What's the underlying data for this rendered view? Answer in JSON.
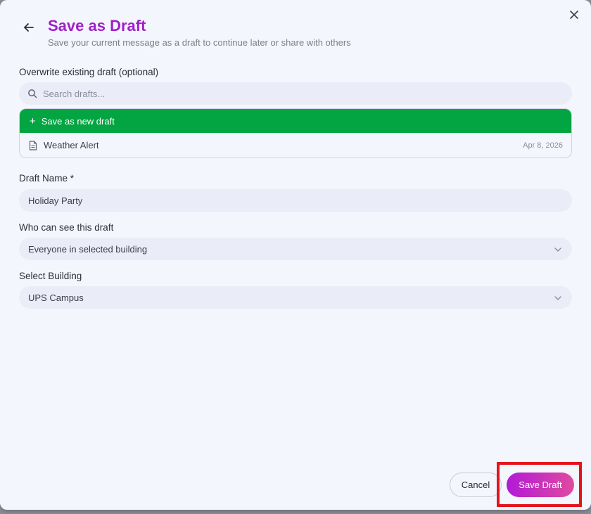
{
  "dialog": {
    "title": "Save as Draft",
    "subtitle": "Save your current message as a draft to continue later or share with others"
  },
  "overwrite": {
    "label": "Overwrite existing draft (optional)",
    "search_placeholder": "Search drafts...",
    "new_draft_label": "Save as new draft",
    "drafts": [
      {
        "name": "Weather Alert",
        "date": "Apr 8, 2026"
      }
    ]
  },
  "draft_name": {
    "label": "Draft Name *",
    "value": "Holiday Party"
  },
  "visibility": {
    "label": "Who can see this draft",
    "value": "Everyone in selected building"
  },
  "building": {
    "label": "Select Building",
    "value": "UPS Campus"
  },
  "actions": {
    "cancel_label": "Cancel",
    "save_label": "Save Draft"
  },
  "colors": {
    "title": "#a020c8",
    "new_draft_bg": "#02a541",
    "save_gradient_start": "#b11ad6",
    "save_gradient_end": "#e04aa0",
    "highlight": "#e4141c"
  }
}
